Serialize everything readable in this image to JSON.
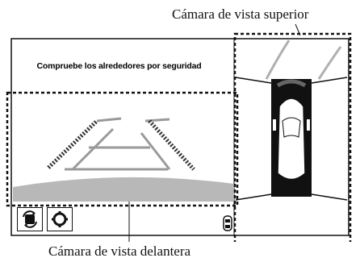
{
  "callouts": {
    "top_view": "Cámara de vista superior",
    "front_view": "Cámara de vista delantera"
  },
  "screen": {
    "message": "Compruebe los alrededores por seguridad"
  },
  "buttons": [
    {
      "name": "camera-switch-button",
      "icon": "camera-switch-icon"
    },
    {
      "name": "settings-button",
      "icon": "gear-icon"
    }
  ],
  "status_icons": [
    {
      "name": "car-sensor-icon"
    }
  ],
  "colors": {
    "line": "#111111",
    "ground": "#b8b8b8",
    "guide_gray": "#9a9a9a",
    "guide_dark": "#333333"
  }
}
